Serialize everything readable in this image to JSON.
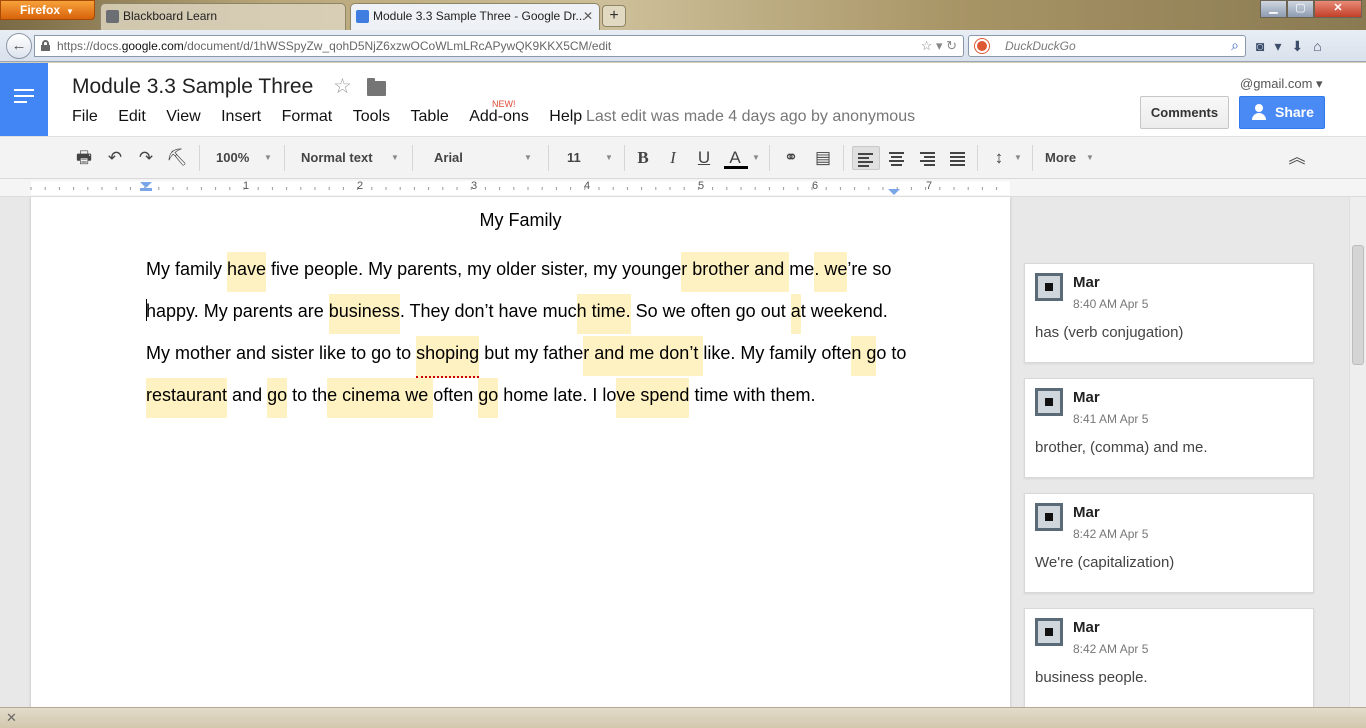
{
  "browser": {
    "button": "Firefox",
    "tabs": [
      {
        "title": "Blackboard Learn"
      },
      {
        "title": "Module 3.3 Sample Three - Google Dr..."
      }
    ],
    "url_prefix": "https://docs.",
    "url_domain": "google.com",
    "url_path": "/document/d/1hWSSpyZw_qohD5NjZ6xzwOCoWLmLRcAPywQK9KKX5CM/edit",
    "search_placeholder": "DuckDuckGo"
  },
  "doc": {
    "title": "Module 3.3 Sample Three",
    "menu": [
      "File",
      "Edit",
      "View",
      "Insert",
      "Format",
      "Tools",
      "Table",
      "Add-ons",
      "Help"
    ],
    "new_badge": "NEW!",
    "last_edit": "Last edit was made 4 days ago by anonymous",
    "account": "@gmail.com",
    "comments_button": "Comments",
    "share_button": "Share"
  },
  "toolbar": {
    "zoom": "100%",
    "style": "Normal text",
    "font": "Arial",
    "size": "11",
    "bold": "B",
    "italic": "I",
    "underline": "U",
    "text_color": "A",
    "more": "More"
  },
  "ruler": {
    "numbers": [
      "1",
      "2",
      "3",
      "4",
      "5",
      "6",
      "7"
    ]
  },
  "content": {
    "heading": "My Family",
    "lines": [
      [
        {
          "t": "My family "
        },
        {
          "t": "have",
          "h": true
        },
        {
          "t": " five people. My parents, my older sister, my younge"
        },
        {
          "t": "r brother and ",
          "h": true
        },
        {
          "t": "me"
        },
        {
          "t": ". we",
          "h": true
        },
        {
          "t": "’re so"
        }
      ],
      [
        {
          "t": "happy. My parents are "
        },
        {
          "t": "business",
          "h": true
        },
        {
          "t": ". They don’t have muc"
        },
        {
          "t": "h time.",
          "h": true
        },
        {
          "t": " So we often go out "
        },
        {
          "t": "a",
          "h": true
        },
        {
          "t": "t weekend."
        }
      ],
      [
        {
          "t": "My mother and sister like to go to "
        },
        {
          "t": "shoping",
          "h": true,
          "s": true
        },
        {
          "t": " but my fathe"
        },
        {
          "t": "r and me don’t ",
          "h": true
        },
        {
          "t": "like. My family ofte"
        },
        {
          "t": "n g",
          "h": true
        },
        {
          "t": "o to"
        }
      ],
      [
        {
          "t": "restaurant",
          "h": true
        },
        {
          "t": " and "
        },
        {
          "t": "go",
          "h": true
        },
        {
          "t": " to th"
        },
        {
          "t": "e cinema we ",
          "h": true
        },
        {
          "t": "often "
        },
        {
          "t": "go",
          "h": true
        },
        {
          "t": " home late. I lo"
        },
        {
          "t": "ve spend",
          "h": true
        },
        {
          "t": " time with them."
        }
      ]
    ]
  },
  "comments": [
    {
      "author": "Mar",
      "time": "8:40 AM Apr 5",
      "text": "has (verb conjugation)"
    },
    {
      "author": "Mar",
      "time": "8:41 AM Apr 5",
      "text": "brother, (comma) and me."
    },
    {
      "author": "Mar",
      "time": "8:42 AM Apr 5",
      "text": "We're (capitalization)"
    },
    {
      "author": "Mar",
      "time": "8:42 AM Apr 5",
      "text": "business people."
    }
  ],
  "colors": {
    "docs_blue": "#4285f4",
    "highlight": "#fff2c2",
    "share": "#4a8af4"
  }
}
